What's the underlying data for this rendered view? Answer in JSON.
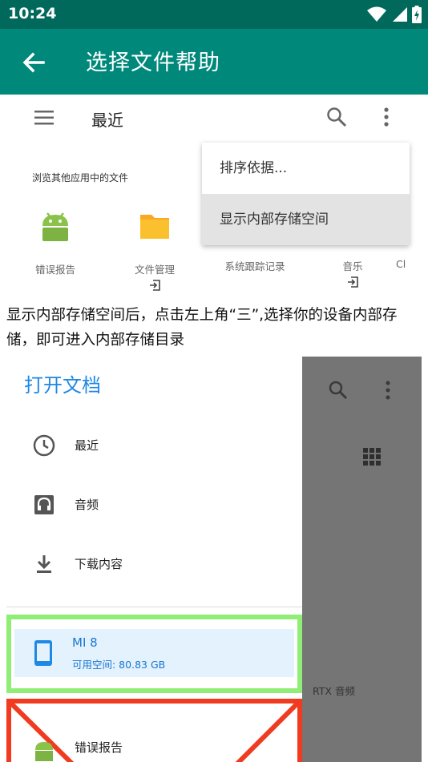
{
  "status_bar": {
    "time": "10:24"
  },
  "app_bar": {
    "title": "选择文件帮助"
  },
  "shot1": {
    "title": "最近",
    "browse_label": "浏览其他应用中的文件",
    "apps": [
      {
        "label": "错误报告"
      },
      {
        "label": "文件管理"
      },
      {
        "label": "系统跟踪记录"
      },
      {
        "label": "音乐"
      },
      {
        "label": "Cl"
      }
    ],
    "menu": [
      {
        "label": "排序依据..."
      },
      {
        "label": "显示内部存储空间"
      }
    ]
  },
  "caption": "显示内部存储空间后，点击左上角“三”,选择你的设备内部存储，即可进入内部存储目录",
  "shot2": {
    "drawer_title": "打开文档",
    "items": [
      {
        "label": "最近"
      },
      {
        "label": "音频"
      },
      {
        "label": "下载内容"
      }
    ],
    "storage": {
      "name": "MI 8",
      "free": "可用空间: 80.83 GB"
    },
    "bug_report": "错误报告",
    "behind_label": "RTX 音频"
  },
  "colors": {
    "status_bar": "#00695c",
    "app_bar": "#00897b",
    "accent_blue": "#1e88e5",
    "highlight_green": "#90ee76",
    "highlight_red": "#f03b20"
  }
}
